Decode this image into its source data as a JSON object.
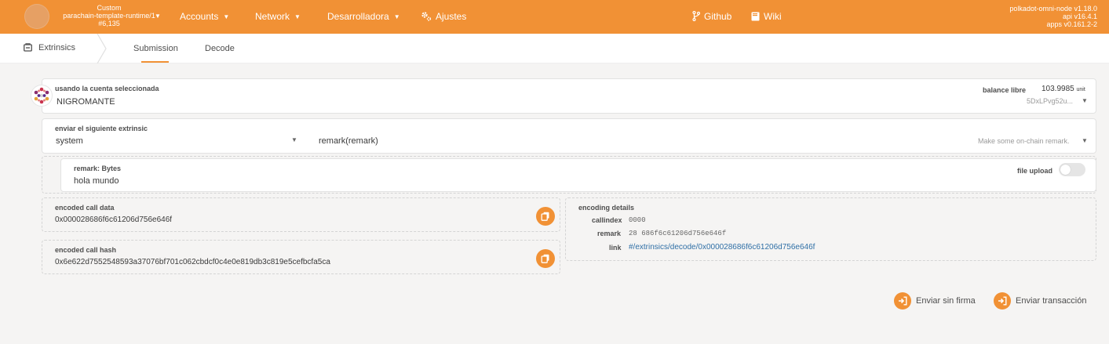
{
  "colors": {
    "accent": "#f19135",
    "link": "#2f6fa6",
    "background": "#f5f4f3"
  },
  "header": {
    "chain": {
      "name": "Custom",
      "runtime": "parachain-template-runtime/1",
      "block": "#6,135"
    },
    "nav": [
      {
        "label": "Accounts",
        "icon": ""
      },
      {
        "label": "Network",
        "icon": ""
      },
      {
        "label": "Desarrolladora",
        "icon": ""
      },
      {
        "label": "Ajustes",
        "icon": "gear-icon"
      }
    ],
    "links": [
      {
        "label": "Github",
        "icon": "fork-icon"
      },
      {
        "label": "Wiki",
        "icon": "book-icon"
      }
    ],
    "node": {
      "name": "polkadot-omni-node v1.18.0",
      "api": "api v16.4.1",
      "apps": "apps v0.161.2-2"
    }
  },
  "tabs": {
    "section": "Extrinsics",
    "items": [
      "Submission",
      "Decode"
    ],
    "active": "Submission"
  },
  "account": {
    "label": "usando la cuenta seleccionada",
    "name": "NIGROMANTE",
    "balance_label": "balance libre",
    "balance_value": "103.9985",
    "balance_unit": "unit",
    "address": "5DxLPvg52u..."
  },
  "extrinsic": {
    "label": "enviar el siguiente extrinsic",
    "pallet": "system",
    "call": "remark(remark)",
    "description": "Make some on-chain remark."
  },
  "param": {
    "label": "remark: Bytes",
    "value": "hola mundo",
    "file_upload_label": "file upload",
    "file_upload_on": false
  },
  "encoded": {
    "call_data_label": "encoded call data",
    "call_data": "0x000028686f6c61206d756e646f",
    "call_hash_label": "encoded call hash",
    "call_hash": "0x6e622d7552548593a37076bf701c062cbdcf0c4e0e819db3c819e5cefbcfa5ca"
  },
  "encoding_details": {
    "title": "encoding details",
    "callindex_label": "callindex",
    "callindex": "0000",
    "remark_label": "remark",
    "remark": "28 686f6c61206d756e646f",
    "link_label": "link",
    "link": "#/extrinsics/decode/0x000028686f6c61206d756e646f"
  },
  "actions": {
    "unsigned": "Enviar sin firma",
    "submit": "Enviar transacción"
  }
}
